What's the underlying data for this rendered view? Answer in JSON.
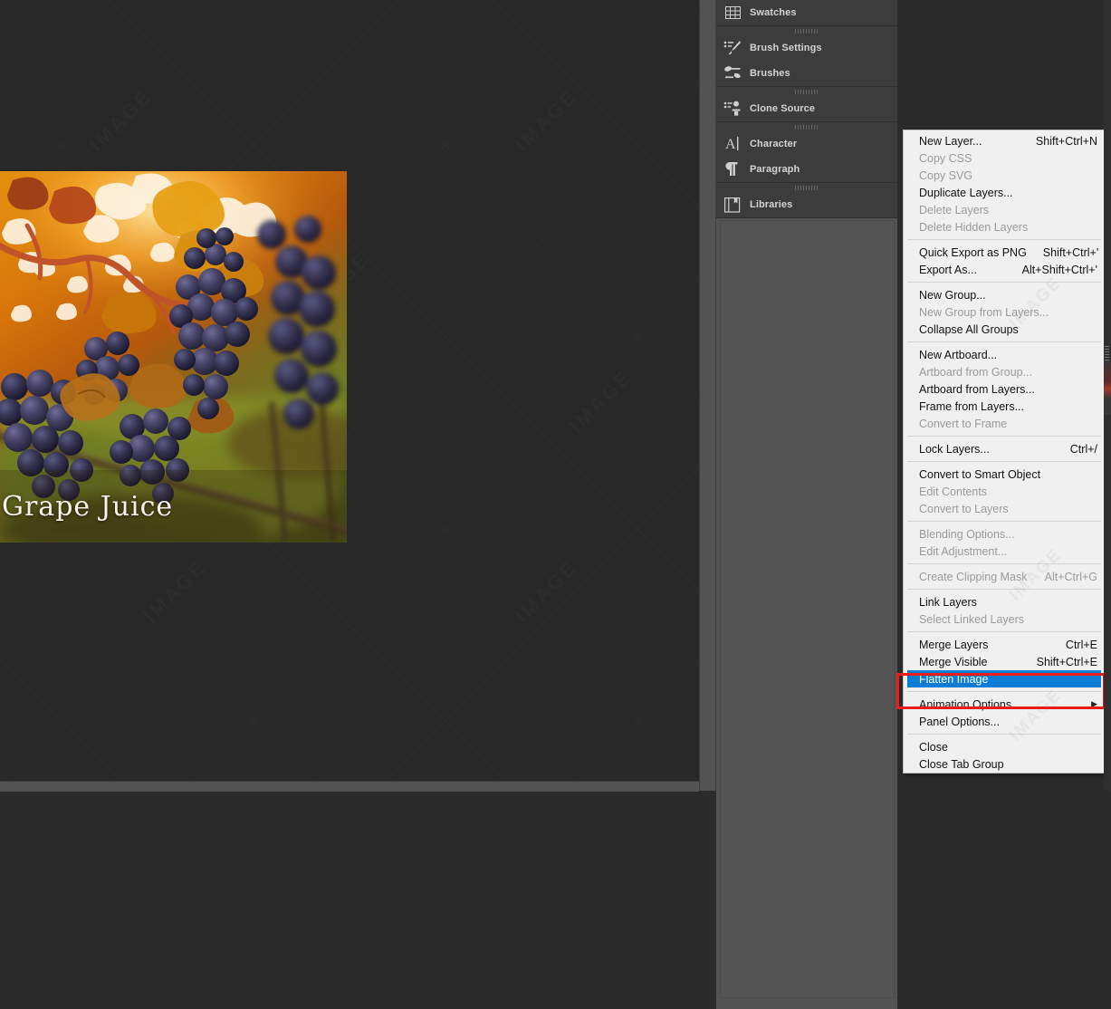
{
  "document": {
    "caption": "Grape Juice",
    "image_alt": "photo-of-purple-grapes-on-vine"
  },
  "dock": {
    "groups": [
      {
        "has_grip": false,
        "items": [
          {
            "label": "Swatches",
            "icon": "swatches-grid-icon"
          }
        ]
      },
      {
        "has_grip": true,
        "items": [
          {
            "label": "Brush Settings",
            "icon": "brush-settings-icon"
          },
          {
            "label": "Brushes",
            "icon": "brushes-icon"
          }
        ]
      },
      {
        "has_grip": true,
        "items": [
          {
            "label": "Clone Source",
            "icon": "clone-source-stamp-icon"
          }
        ]
      },
      {
        "has_grip": true,
        "items": [
          {
            "label": "Character",
            "icon": "character-a-icon"
          },
          {
            "label": "Paragraph",
            "icon": "paragraph-pilcrow-icon"
          }
        ]
      },
      {
        "has_grip": true,
        "items": [
          {
            "label": "Libraries",
            "icon": "libraries-book-icon"
          }
        ]
      }
    ]
  },
  "context_menu": {
    "highlight_color": "#0c7cd5",
    "background_color": "#f0f0f0",
    "annotation_color": "#ee1b1b",
    "sections": [
      {
        "items": [
          {
            "label": "New Layer...",
            "shortcut": "Shift+Ctrl+N",
            "state": "enabled"
          },
          {
            "label": "Copy CSS",
            "shortcut": "",
            "state": "disabled"
          },
          {
            "label": "Copy SVG",
            "shortcut": "",
            "state": "disabled"
          },
          {
            "label": "Duplicate Layers...",
            "shortcut": "",
            "state": "enabled"
          },
          {
            "label": "Delete Layers",
            "shortcut": "",
            "state": "disabled"
          },
          {
            "label": "Delete Hidden Layers",
            "shortcut": "",
            "state": "disabled"
          }
        ]
      },
      {
        "items": [
          {
            "label": "Quick Export as PNG",
            "shortcut": "Shift+Ctrl+'",
            "state": "enabled"
          },
          {
            "label": "Export As...",
            "shortcut": "Alt+Shift+Ctrl+'",
            "state": "enabled"
          }
        ]
      },
      {
        "items": [
          {
            "label": "New Group...",
            "shortcut": "",
            "state": "enabled"
          },
          {
            "label": "New Group from Layers...",
            "shortcut": "",
            "state": "disabled"
          },
          {
            "label": "Collapse All Groups",
            "shortcut": "",
            "state": "enabled"
          }
        ]
      },
      {
        "items": [
          {
            "label": "New Artboard...",
            "shortcut": "",
            "state": "enabled"
          },
          {
            "label": "Artboard from Group...",
            "shortcut": "",
            "state": "disabled"
          },
          {
            "label": "Artboard from Layers...",
            "shortcut": "",
            "state": "enabled"
          },
          {
            "label": "Frame from Layers...",
            "shortcut": "",
            "state": "enabled"
          },
          {
            "label": "Convert to Frame",
            "shortcut": "",
            "state": "disabled"
          }
        ]
      },
      {
        "items": [
          {
            "label": "Lock Layers...",
            "shortcut": "Ctrl+/",
            "state": "enabled"
          }
        ]
      },
      {
        "items": [
          {
            "label": "Convert to Smart Object",
            "shortcut": "",
            "state": "enabled"
          },
          {
            "label": "Edit Contents",
            "shortcut": "",
            "state": "disabled"
          },
          {
            "label": "Convert to Layers",
            "shortcut": "",
            "state": "disabled"
          }
        ]
      },
      {
        "items": [
          {
            "label": "Blending Options...",
            "shortcut": "",
            "state": "disabled"
          },
          {
            "label": "Edit Adjustment...",
            "shortcut": "",
            "state": "disabled"
          }
        ]
      },
      {
        "items": [
          {
            "label": "Create Clipping Mask",
            "shortcut": "Alt+Ctrl+G",
            "state": "disabled"
          }
        ]
      },
      {
        "items": [
          {
            "label": "Link Layers",
            "shortcut": "",
            "state": "enabled"
          },
          {
            "label": "Select Linked Layers",
            "shortcut": "",
            "state": "disabled"
          }
        ]
      },
      {
        "items": [
          {
            "label": "Merge Layers",
            "shortcut": "Ctrl+E",
            "state": "enabled"
          },
          {
            "label": "Merge Visible",
            "shortcut": "Shift+Ctrl+E",
            "state": "enabled"
          },
          {
            "label": "Flatten Image",
            "shortcut": "",
            "state": "selected"
          }
        ]
      },
      {
        "items": [
          {
            "label": "Animation Options",
            "shortcut": "",
            "state": "enabled",
            "submenu": true
          },
          {
            "label": "Panel Options...",
            "shortcut": "",
            "state": "enabled"
          }
        ]
      },
      {
        "items": [
          {
            "label": "Close",
            "shortcut": "",
            "state": "enabled"
          },
          {
            "label": "Close Tab Group",
            "shortcut": "",
            "state": "enabled"
          }
        ]
      }
    ]
  },
  "watermark": {
    "text": "IMAGE"
  }
}
